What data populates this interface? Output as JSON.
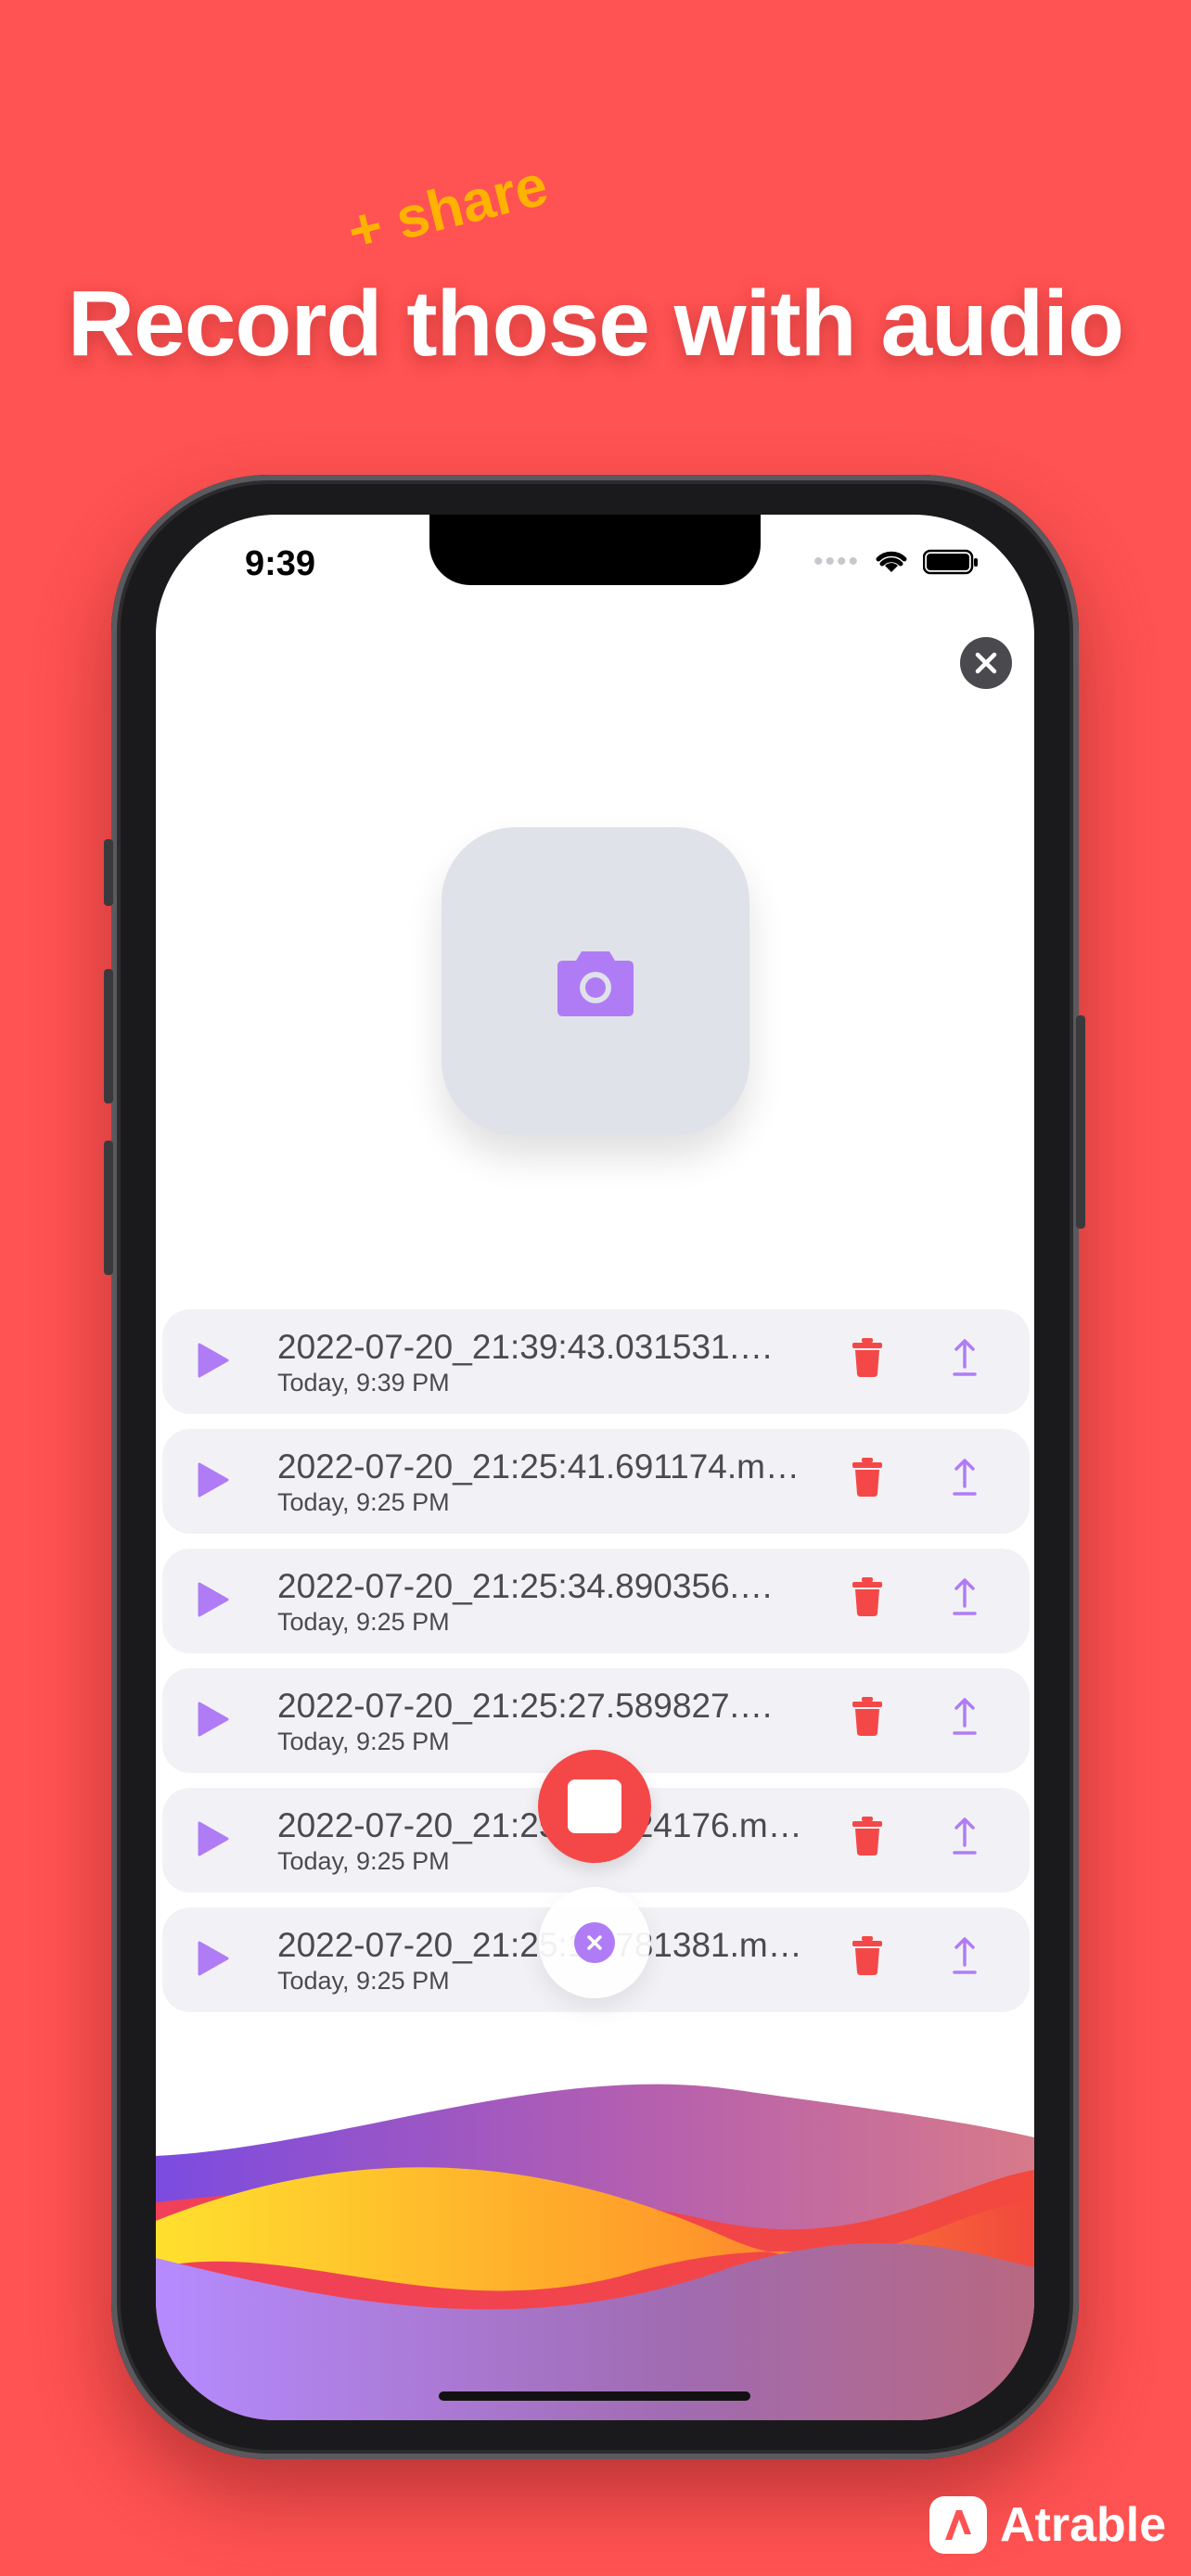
{
  "headline": {
    "main": "Record those with audio",
    "tag": "+ share"
  },
  "status_bar": {
    "time": "9:39"
  },
  "recordings": [
    {
      "name": "2022-07-20_21:39:43.031531.…",
      "date": "Today, 9:39 PM"
    },
    {
      "name": "2022-07-20_21:25:41.691174.m…",
      "date": "Today, 9:25 PM"
    },
    {
      "name": "2022-07-20_21:25:34.890356.…",
      "date": "Today, 9:25 PM"
    },
    {
      "name": "2022-07-20_21:25:27.589827.…",
      "date": "Today, 9:25 PM"
    },
    {
      "name": "2022-07-20_21:25:20.924176.m…",
      "date": "Today, 9:25 PM"
    },
    {
      "name": "2022-07-20_21:25:13.781381.m…",
      "date": "Today, 9:25 PM"
    }
  ],
  "brand": {
    "name": "Atrable"
  },
  "colors": {
    "background": "#FF5252",
    "accent_purple": "#B07CF5",
    "delete_red": "#F44848",
    "tag_orange": "#FFB300"
  },
  "icons": {
    "play": "play-icon",
    "delete": "trash-icon",
    "share": "share-icon",
    "camera": "camera-icon",
    "close": "close-icon",
    "stop": "stop-icon"
  }
}
